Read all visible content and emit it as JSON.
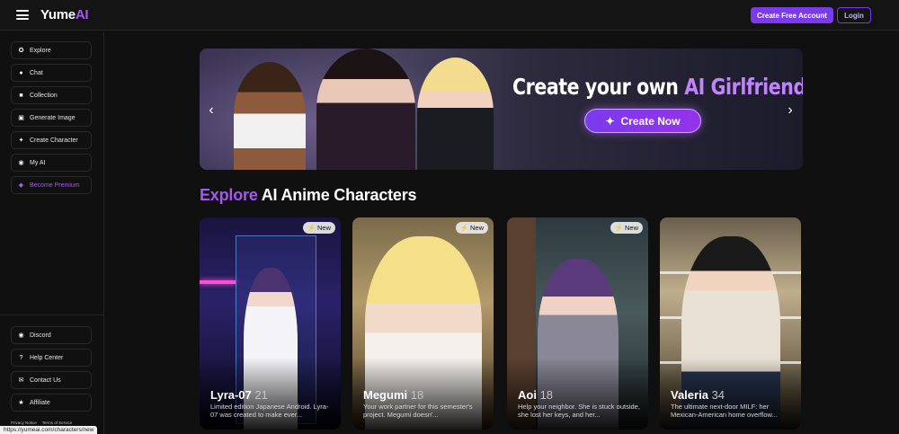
{
  "header": {
    "logo_main": "Yume",
    "logo_accent": "AI",
    "create_account": "Create Free Account",
    "login": "Login"
  },
  "sidebar": {
    "items": [
      {
        "label": "Explore",
        "icon": "compass-icon"
      },
      {
        "label": "Chat",
        "icon": "chat-bubble-icon"
      },
      {
        "label": "Collection",
        "icon": "folder-icon"
      },
      {
        "label": "Generate Image",
        "icon": "image-icon"
      },
      {
        "label": "Create Character",
        "icon": "magic-wand-icon"
      },
      {
        "label": "My AI",
        "icon": "mask-icon"
      },
      {
        "label": "Become Premium",
        "icon": "diamond-icon"
      }
    ],
    "bottom_items": [
      {
        "label": "Discord",
        "icon": "discord-icon"
      },
      {
        "label": "Help Center",
        "icon": "help-circle-icon"
      },
      {
        "label": "Contact Us",
        "icon": "mail-icon"
      },
      {
        "label": "Affiliate",
        "icon": "trophy-icon"
      }
    ],
    "privacy": "Privacy Notice",
    "terms": "Terms of Service"
  },
  "status_url": "https://yumeai.com/characters/new",
  "banner": {
    "title_main": "Create your own ",
    "title_accent": "AI Girlfriend",
    "cta": "Create Now"
  },
  "section": {
    "heading_accent": "Explore",
    "heading_main": " AI Anime Characters"
  },
  "cards": [
    {
      "badge": "New",
      "name": "Lyra-07",
      "age": "21",
      "description": "Limited edition Japanese Android. Lyra-07 was created to make ever..."
    },
    {
      "badge": "New",
      "name": "Megumi",
      "age": "18",
      "description": "Your work partner for this semester's project. Megumi doesn'..."
    },
    {
      "badge": "New",
      "name": "Aoi",
      "age": "18",
      "description": "Help your neighbor. She is stuck outside, she lost her keys, and her..."
    },
    {
      "badge": "",
      "name": "Valeria",
      "age": "34",
      "description": "The ultimate next-door MILF: her Mexican-American home overflow..."
    }
  ],
  "colors": {
    "accent": "#a855f7",
    "button": "#7c3aed",
    "background": "#101010"
  }
}
